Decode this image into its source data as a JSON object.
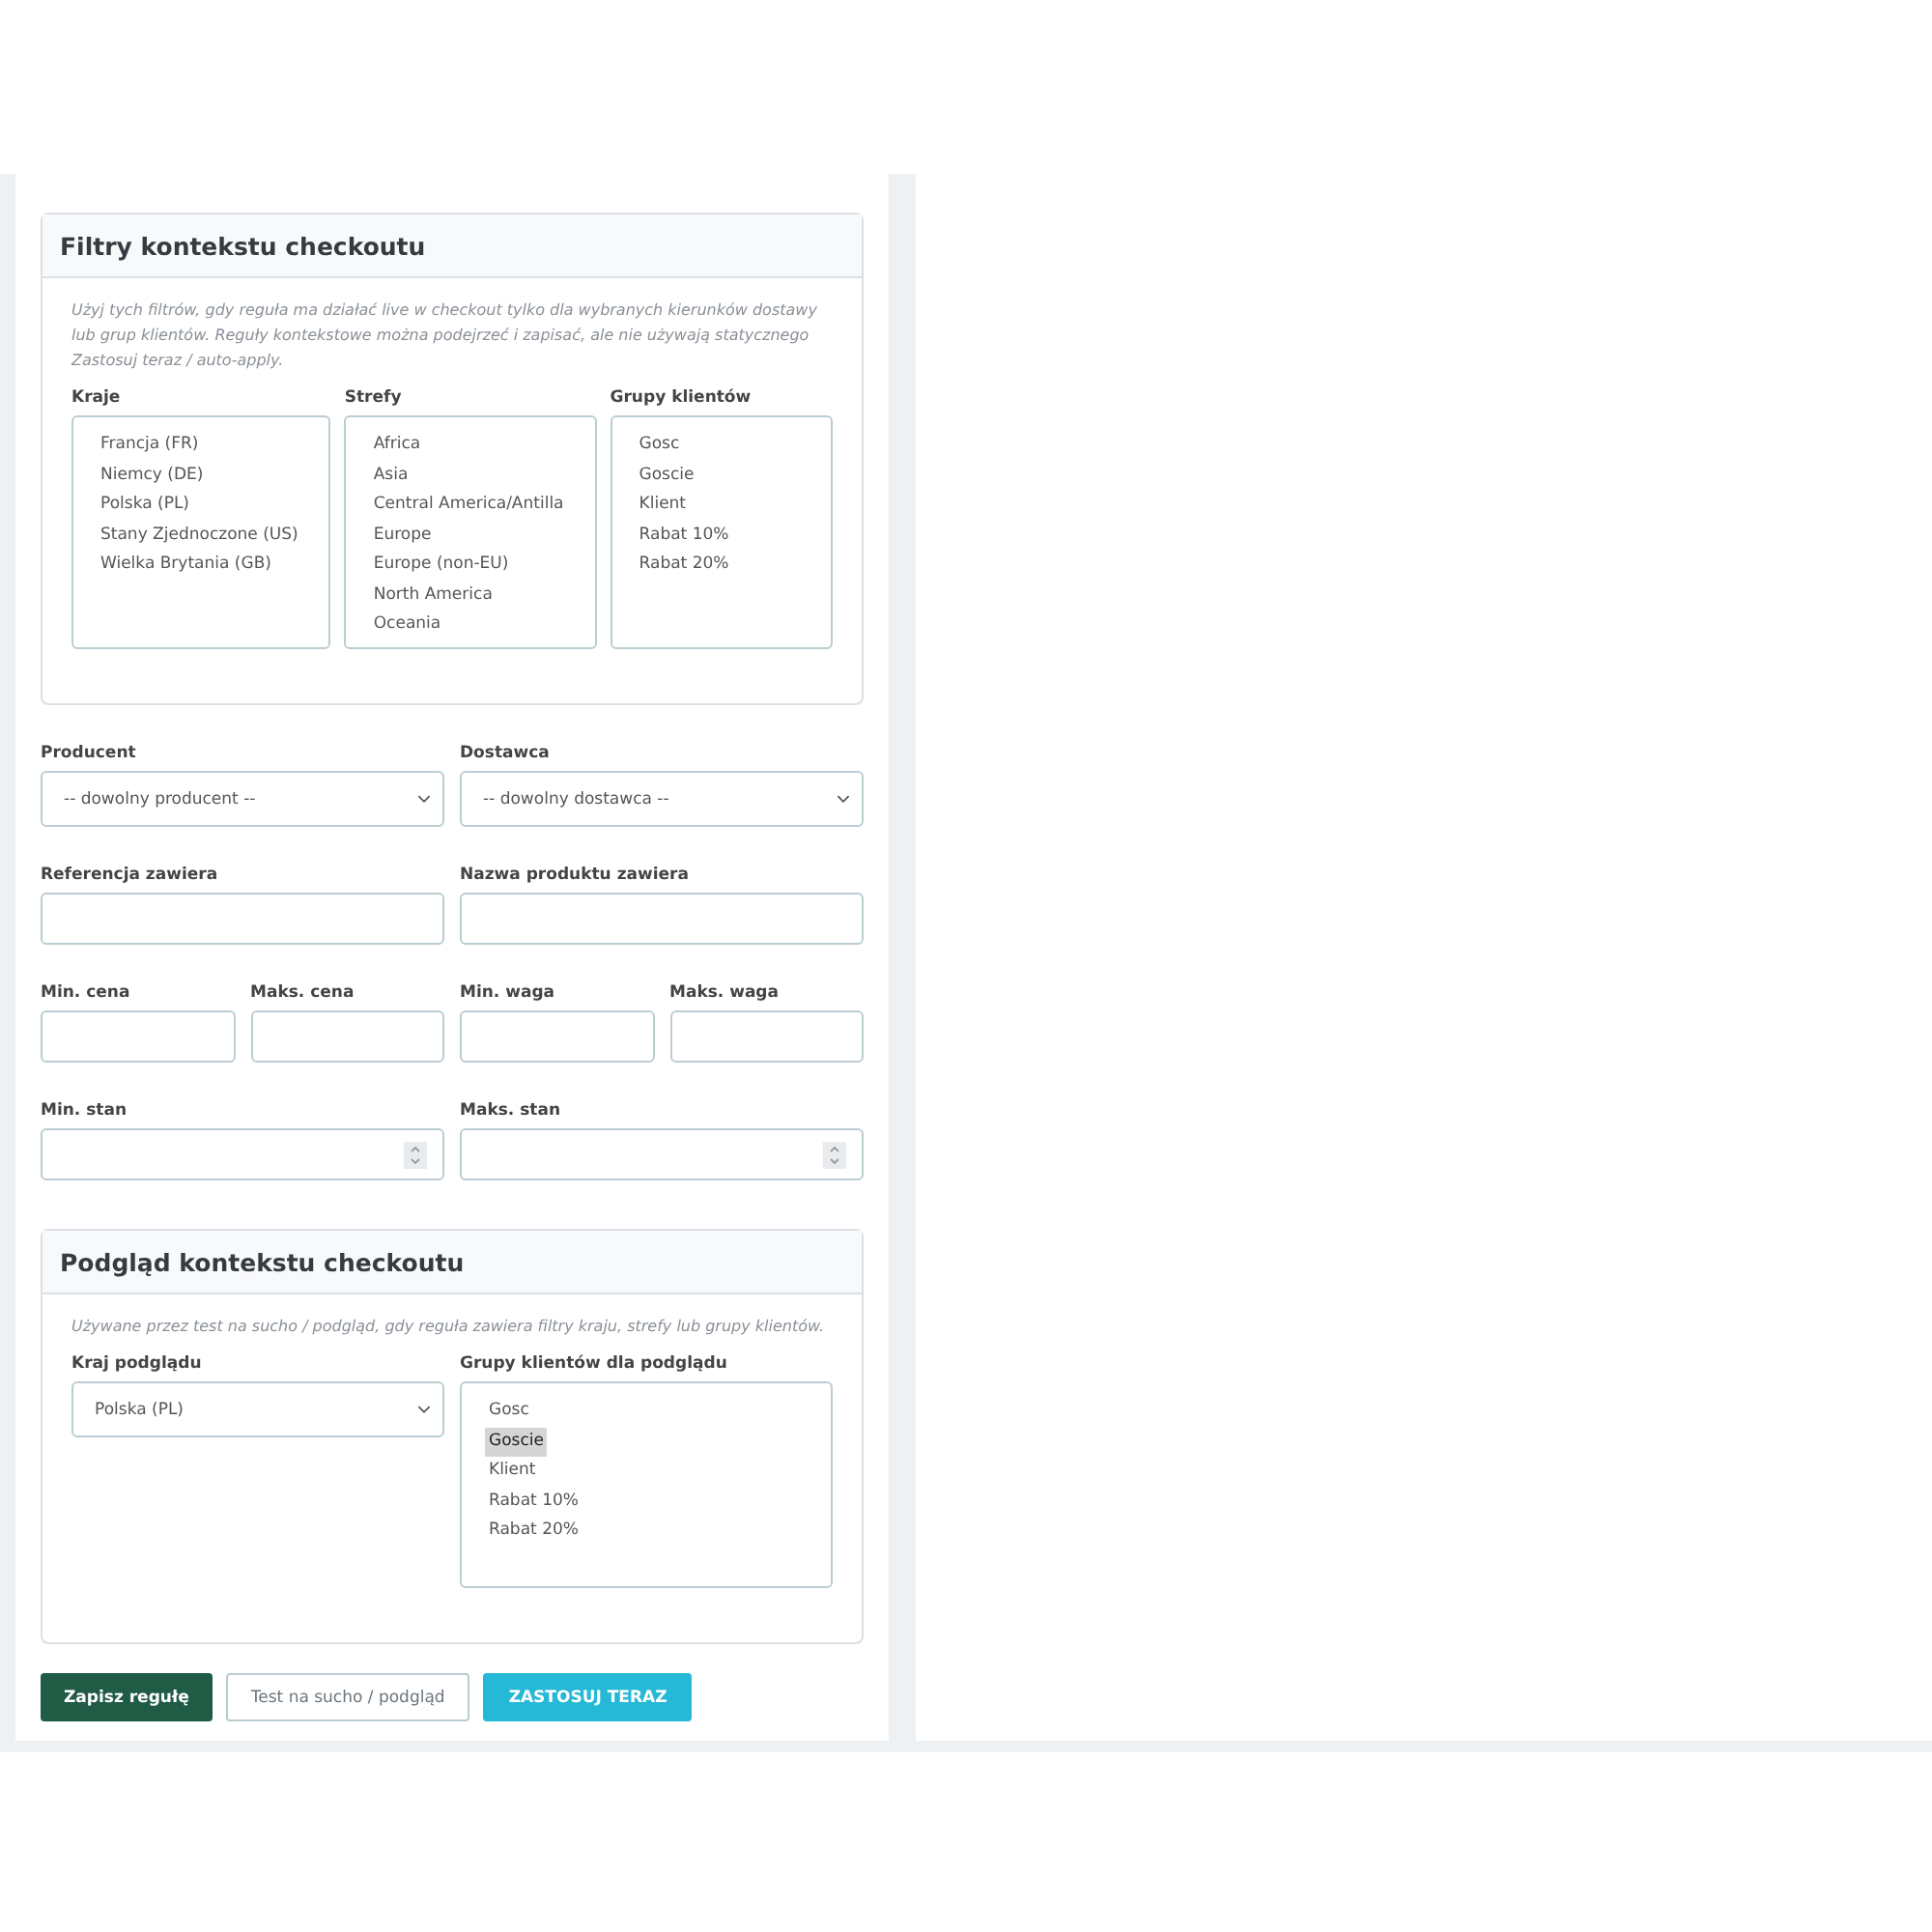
{
  "context_filters": {
    "title": "Filtry kontekstu checkoutu",
    "hint": "Użyj tych filtrów, gdy reguła ma działać live w checkout tylko dla wybranych kierunków dostawy lub grup klientów. Reguły kontekstowe można podejrzeć i zapisać, ale nie używają statycznego Zastosuj teraz / auto-apply.",
    "lists": [
      {
        "label": "Kraje",
        "options": [
          {
            "label": "Francja (FR)",
            "selected": false
          },
          {
            "label": "Niemcy (DE)",
            "selected": false
          },
          {
            "label": "Polska (PL)",
            "selected": false
          },
          {
            "label": "Stany Zjednoczone (US)",
            "selected": false
          },
          {
            "label": "Wielka Brytania (GB)",
            "selected": false
          }
        ]
      },
      {
        "label": "Strefy",
        "options": [
          {
            "label": "Africa",
            "selected": false
          },
          {
            "label": "Asia",
            "selected": false
          },
          {
            "label": "Central America/Antilla",
            "selected": false
          },
          {
            "label": "Europe",
            "selected": false
          },
          {
            "label": "Europe (non-EU)",
            "selected": false
          },
          {
            "label": "North America",
            "selected": false
          },
          {
            "label": "Oceania",
            "selected": false
          }
        ]
      },
      {
        "label": "Grupy klientów",
        "options": [
          {
            "label": "Gosc",
            "selected": false
          },
          {
            "label": "Goscie",
            "selected": false
          },
          {
            "label": "Klient",
            "selected": false
          },
          {
            "label": "Rabat 10%",
            "selected": false
          },
          {
            "label": "Rabat 20%",
            "selected": false
          }
        ]
      }
    ]
  },
  "field_rows": [
    [
      {
        "label": "Producent",
        "kind": "select",
        "value": "-- dowolny producent --"
      },
      {
        "label": "Dostawca",
        "kind": "select",
        "value": "-- dowolny dostawca --"
      }
    ],
    [
      {
        "label": "Referencja zawiera",
        "kind": "text"
      },
      {
        "label": "Nazwa produktu zawiera",
        "kind": "text"
      }
    ],
    [
      {
        "label": "Min. cena",
        "kind": "text"
      },
      {
        "label": "Maks. cena",
        "kind": "text"
      },
      {
        "label": "Min. waga",
        "kind": "text"
      },
      {
        "label": "Maks. waga",
        "kind": "text"
      }
    ],
    [
      {
        "label": "Min. stan",
        "kind": "number"
      },
      {
        "label": "Maks. stan",
        "kind": "number"
      }
    ]
  ],
  "preview": {
    "title": "Podgląd kontekstu checkoutu",
    "hint": "Używane przez test na sucho / podgląd, gdy reguła zawiera filtry kraju, strefy lub grupy klientów.",
    "country": {
      "label": "Kraj podglądu",
      "value": "Polska (PL)"
    },
    "groups": {
      "label": "Grupy klientów dla podglądu",
      "options": [
        {
          "label": "Gosc",
          "selected": false
        },
        {
          "label": "Goscie",
          "selected": true
        },
        {
          "label": "Klient",
          "selected": false
        },
        {
          "label": "Rabat 10%",
          "selected": false
        },
        {
          "label": "Rabat 20%",
          "selected": false
        }
      ]
    }
  },
  "buttons": [
    {
      "label": "Zapisz regułę",
      "kind": "primary"
    },
    {
      "label": "Test na sucho / podgląd",
      "kind": "outline"
    },
    {
      "label": "ZASTOSUJ TERAZ",
      "kind": "info"
    }
  ]
}
